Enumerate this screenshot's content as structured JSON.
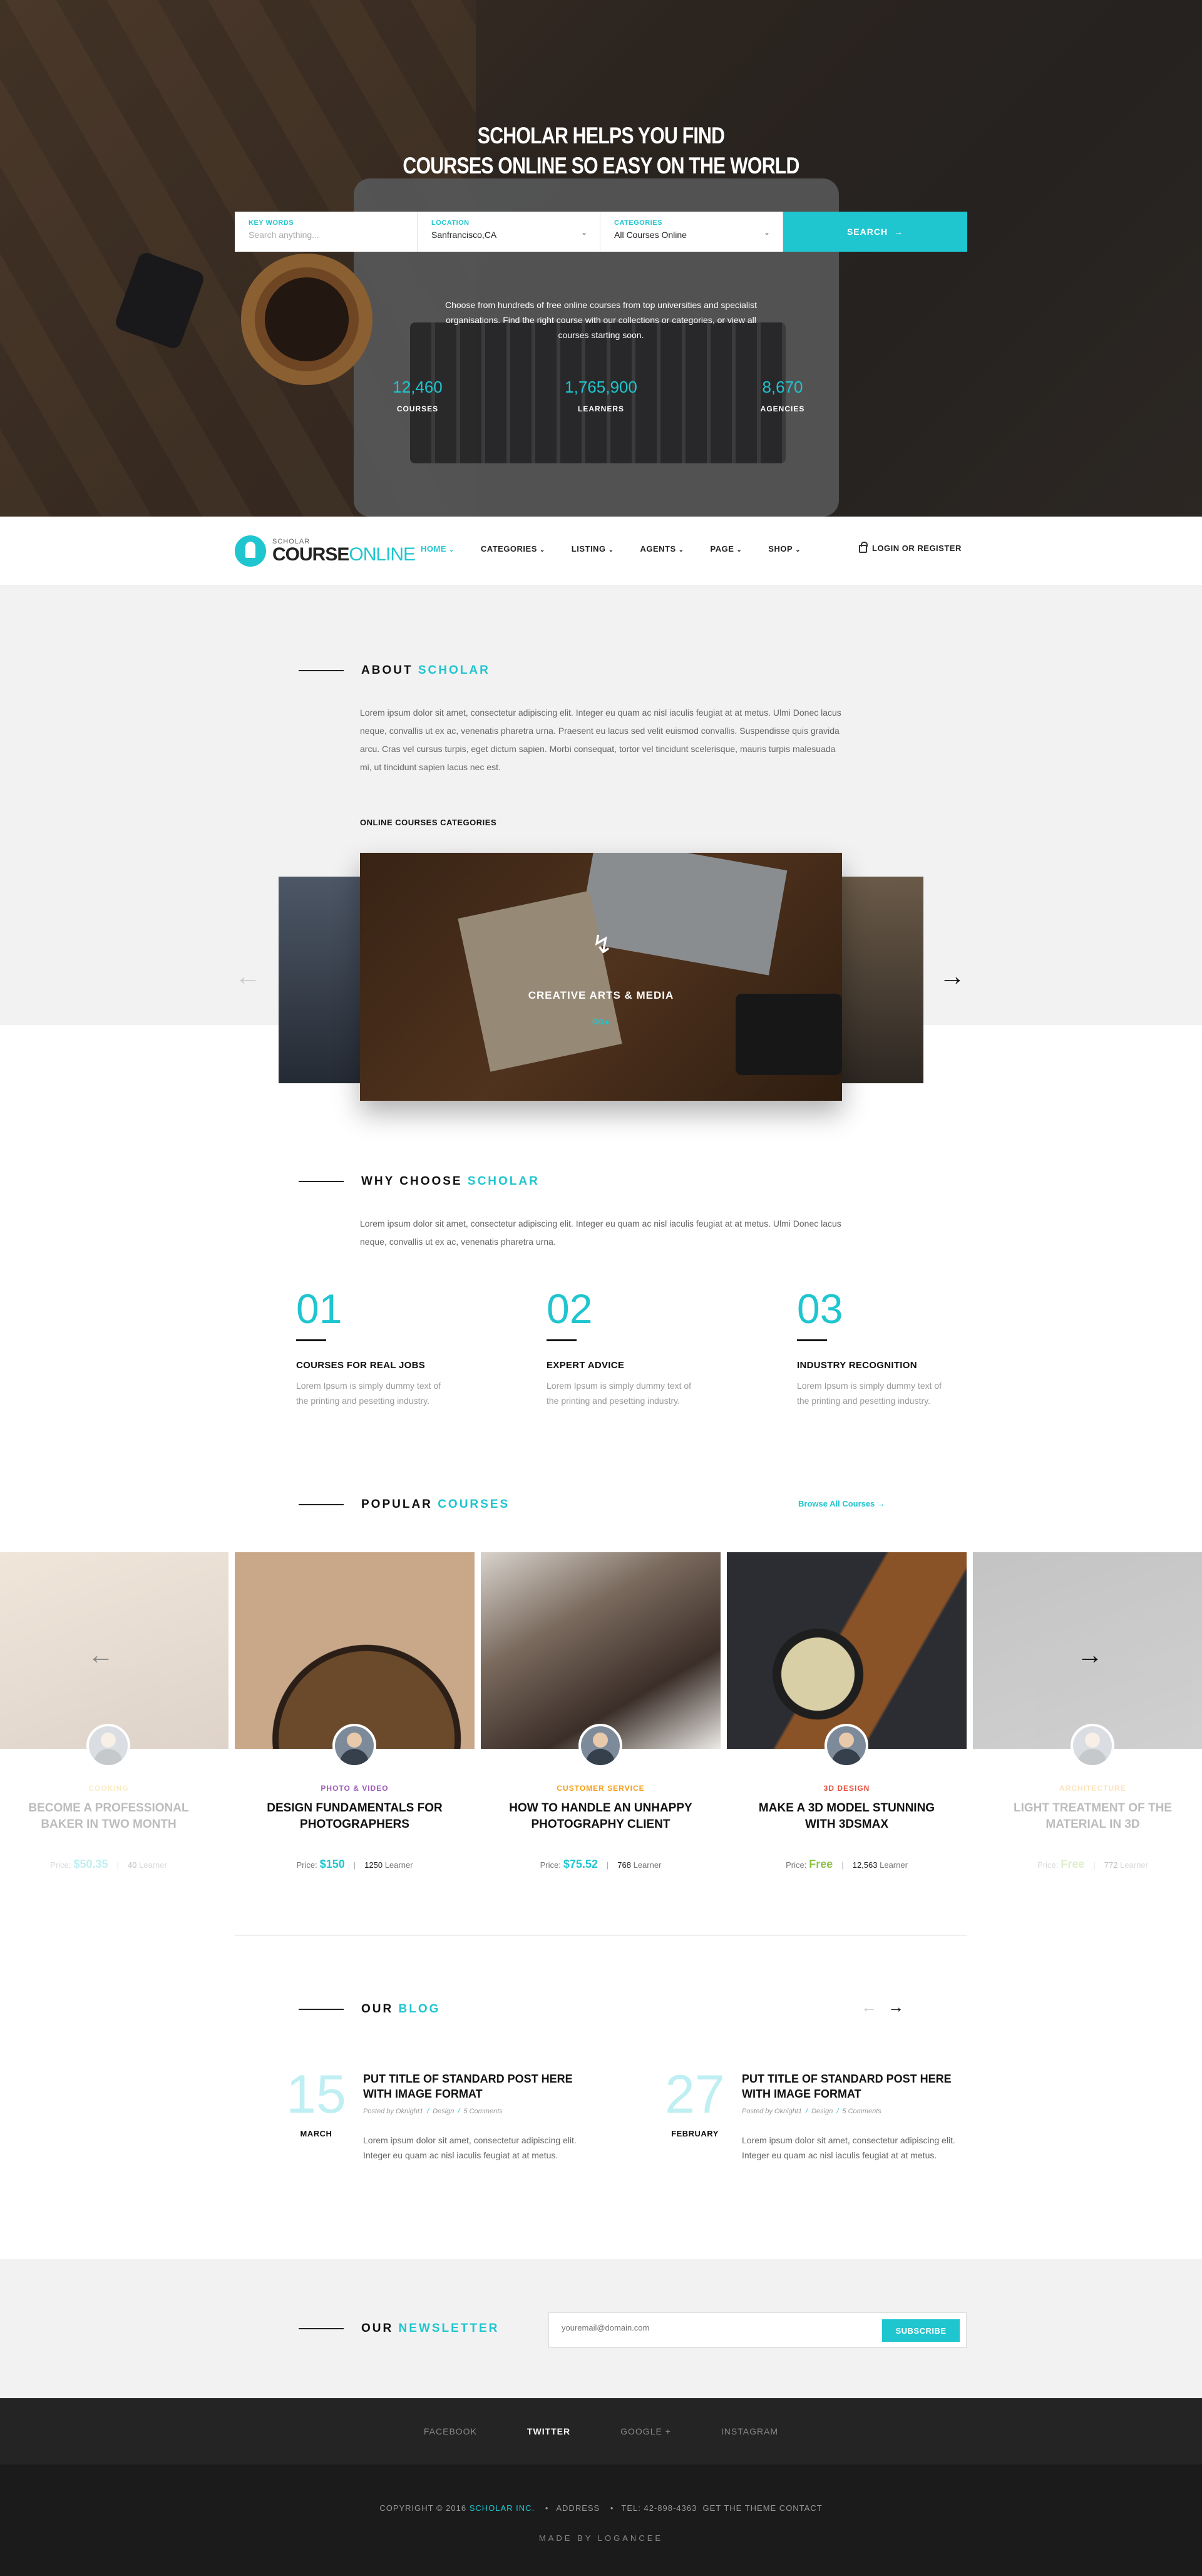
{
  "hero": {
    "title_line1": "SCHOLAR HELPS YOU FIND",
    "title_line2": "COURSES ONLINE SO EASY ON THE WORLD",
    "search": {
      "keywords_label": "KEY WORDS",
      "keywords_placeholder": "Search anything...",
      "location_label": "LOCATION",
      "location_value": "Sanfrancisco,CA",
      "categories_label": "CATEGORIES",
      "categories_value": "All Courses Online",
      "button": "SEARCH"
    },
    "description": "Choose from hundreds of free online courses from top universities and specialist organisations. Find the right course with our collections or categories, or view all courses starting soon.",
    "stats": [
      {
        "value": "12,460",
        "label": "COURSES"
      },
      {
        "value": "1,765,900",
        "label": "LEARNERS"
      },
      {
        "value": "8,670",
        "label": "AGENCIES"
      }
    ]
  },
  "nav": {
    "logo_small": "SCHOLAR",
    "logo_main": "COURSE",
    "logo_accent": "ONLINE",
    "items": [
      "HOME",
      "CATEGORIES",
      "LISTING",
      "AGENTS",
      "PAGE",
      "SHOP"
    ],
    "login": "LOGIN OR REGISTER"
  },
  "about": {
    "heading": "ABOUT",
    "heading_accent": "SCHOLAR",
    "text": "Lorem ipsum dolor sit amet, consectetur adipiscing elit. Integer eu quam ac nisl iaculis feugiat at at metus. Ulmi Donec lacus neque, convallis ut ex ac, venenatis pharetra urna. Praesent eu lacus sed velit euismod convallis. Suspendisse quis gravida arcu. Cras vel cursus turpis, eget dictum sapien. Morbi consequat, tortor vel tincidunt scelerisque, mauris turpis malesuada mi, ut tincidunt sapien lacus nec est.",
    "categories_title": "ONLINE COURSES CATEGORIES",
    "slide_caption": "CREATIVE ARTS & MEDIA",
    "slide_link": "GO"
  },
  "why": {
    "heading": "WHY CHOOSE",
    "heading_accent": "SCHOLAR",
    "text": "Lorem ipsum dolor sit amet, consectetur adipiscing elit. Integer eu quam ac nisl iaculis feugiat at at metus. Ulmi Donec lacus neque, convallis ut ex ac, venenatis pharetra urna.",
    "features": [
      {
        "num": "01",
        "title": "COURSES FOR REAL JOBS",
        "desc": "Lorem Ipsum is simply dummy text of the printing and pesetting industry."
      },
      {
        "num": "02",
        "title": "EXPERT ADVICE",
        "desc": "Lorem Ipsum is simply dummy text of the printing and pesetting industry."
      },
      {
        "num": "03",
        "title": "INDUSTRY RECOGNITION",
        "desc": "Lorem Ipsum is simply dummy text of the printing and pesetting industry."
      }
    ]
  },
  "popular": {
    "heading": "POPULAR",
    "heading_accent": "COURSES",
    "browse": "Browse All Courses",
    "price_label": "Price:",
    "learner_label": "Learner",
    "courses": [
      {
        "category": "COOKING",
        "category_color": "#e8b923",
        "title": "BECOME A PROFESSIONAL BAKER IN TWO MONTH",
        "price": "$50.35",
        "learners": "40"
      },
      {
        "category": "PHOTO & VIDEO",
        "category_color": "#9b59b6",
        "title": "DESIGN FUNDAMENTALS FOR PHOTOGRAPHERS",
        "price": "$150",
        "learners": "1250"
      },
      {
        "category": "CUSTOMER SERVICE",
        "category_color": "#f39c12",
        "title": "HOW TO HANDLE AN UNHAPPY PHOTOGRAPHY CLIENT",
        "price": "$75.52",
        "learners": "768"
      },
      {
        "category": "3D DESIGN",
        "category_color": "#e74c3c",
        "title": "MAKE A 3D MODEL STUNNING WITH 3DSMAX",
        "price": "Free",
        "learners": "12,563"
      },
      {
        "category": "ARCHITECTURE",
        "category_color": "#f39c12",
        "title": "LIGHT TREATMENT OF THE MATERIAL IN 3D",
        "price": "Free",
        "learners": "772"
      }
    ]
  },
  "blog": {
    "heading": "OUR",
    "heading_accent": "BLOG",
    "posts": [
      {
        "day": "15",
        "month": "MARCH",
        "title": "PUT TITLE OF STANDARD POST HERE WITH IMAGE FORMAT",
        "author": "Posted by Oknight1",
        "category": "Design",
        "comments": "5 Comments",
        "excerpt": "Lorem ipsum dolor sit amet, consectetur adipiscing elit. Integer eu quam ac nisl iaculis feugiat at at metus."
      },
      {
        "day": "27",
        "month": "FEBRUARY",
        "title": "PUT TITLE OF STANDARD POST HERE WITH IMAGE FORMAT",
        "author": "Posted by Oknight1",
        "category": "Design",
        "comments": "5 Comments",
        "excerpt": "Lorem ipsum dolor sit amet, consectetur adipiscing elit. Integer eu quam ac nisl iaculis feugiat at at metus."
      }
    ]
  },
  "newsletter": {
    "heading": "OUR",
    "heading_accent": "NEWSLETTER",
    "placeholder": "youremail@domain.com",
    "button": "SUBSCRIBE"
  },
  "footer": {
    "social": [
      "FACEBOOK",
      "TWITTER",
      "GOOGLE +",
      "INSTAGRAM"
    ],
    "copyright": "COPYRIGHT © 2016",
    "company": "SCHOLAR INC.",
    "address": "ADDRESS",
    "tel": "TEL: 42-898-4363",
    "contact": "GET THE THEME CONTACT",
    "made_by": "MADE BY LOGANCEE"
  },
  "colors": {
    "accent": "#1fc5cf",
    "dark": "#1b1b1b",
    "light_bg": "#f2f2f2"
  }
}
